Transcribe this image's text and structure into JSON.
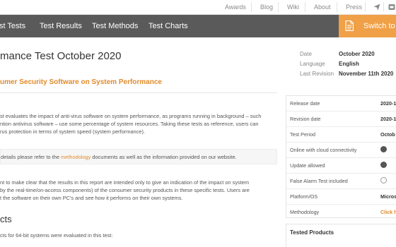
{
  "top_links": [
    {
      "label": "Awards"
    },
    {
      "label": "Blog"
    },
    {
      "label": "Wiki"
    },
    {
      "label": "About"
    },
    {
      "label": "Press"
    }
  ],
  "top_icons": [
    "send-icon",
    "social-icon"
  ],
  "nav": {
    "items": [
      "st Tests",
      "Test Results",
      "Test Methods",
      "Test Charts"
    ],
    "switch_label": "Switch to E",
    "switch_icon": "document-icon"
  },
  "article": {
    "title": "mance Test October 2020",
    "subtitle": "umer Security Software on System Performance",
    "intro": [
      "st evaluates the impact of anti-virus software on system performance, as programs running in background – such",
      "ntion antivirus software – use some percentage of system resources. Taking these tests as reference, users can",
      "rus protection in terms of system speed (system performance)."
    ],
    "note_prefix": "details please refer to the ",
    "note_link": "methodology",
    "note_suffix": " documents as well as the information provided on our website.",
    "para2": [
      "nt to make clear that the results in this report are intended only to give an indication of the impact on system",
      "by the real-time/on-access components) of the consumer security products in these specific tests. Users are",
      "t the software on their own PC's and see how it performs on their own systems."
    ],
    "section_heading": "cts",
    "products_intro": "cts for 64-bit systems were evaluated in this test:"
  },
  "meta": {
    "date_label": "Date",
    "date_value": "October 2020",
    "language_label": "Language",
    "language_value": "English",
    "revision_label": "Last Revision",
    "revision_value": "November 11th 2020"
  },
  "sidebar": {
    "rows": [
      {
        "label": "Release date",
        "value": "2020-1"
      },
      {
        "label": "Revision date",
        "value": "2020-1"
      },
      {
        "label": "Test Period",
        "value": "Octob"
      },
      {
        "label": "Online with cloud connectivity",
        "checked": true
      },
      {
        "label": "Update allowed",
        "checked": true
      },
      {
        "label": "False Alarm Test included",
        "checked": false
      },
      {
        "label": "Platform/OS",
        "value": "Micros"
      },
      {
        "label": "Methodology",
        "value": "Click h"
      }
    ],
    "tested_products_label": "Tested Products"
  },
  "colors": {
    "accent": "#e08b2e",
    "nav_background": "#5a5a5a",
    "switch_background": "#f0a046"
  }
}
